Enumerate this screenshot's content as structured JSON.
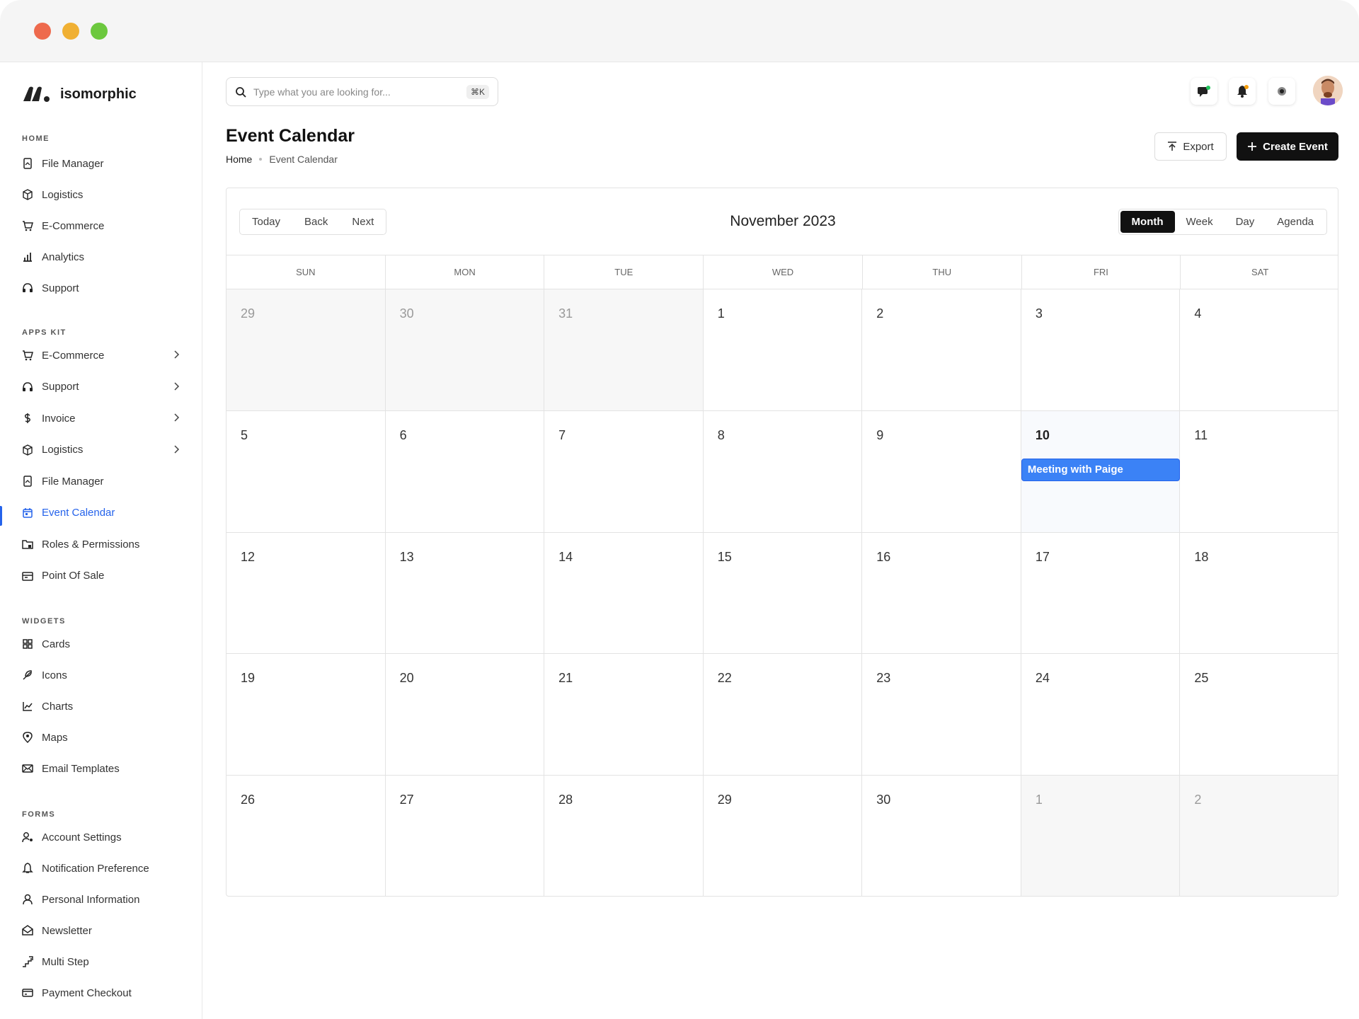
{
  "window": {
    "controls": [
      "close",
      "minimize",
      "maximize"
    ],
    "colors": {
      "close": "#ee6a4d",
      "minimize": "#f0b033",
      "maximize": "#6cc83e"
    }
  },
  "brand": {
    "name": "isomorphic"
  },
  "sidebar": {
    "sections": [
      {
        "label": "HOME",
        "items": [
          {
            "label": "File Manager",
            "icon": "file-icon"
          },
          {
            "label": "Logistics",
            "icon": "box-icon"
          },
          {
            "label": "E-Commerce",
            "icon": "cart-icon"
          },
          {
            "label": "Analytics",
            "icon": "chart-bar-icon"
          },
          {
            "label": "Support",
            "icon": "headset-icon"
          }
        ]
      },
      {
        "label": "APPS KIT",
        "items": [
          {
            "label": "E-Commerce",
            "icon": "cart-icon",
            "expandable": true
          },
          {
            "label": "Support",
            "icon": "headset-icon",
            "expandable": true
          },
          {
            "label": "Invoice",
            "icon": "dollar-icon",
            "expandable": true
          },
          {
            "label": "Logistics",
            "icon": "box-icon",
            "expandable": true
          },
          {
            "label": "File Manager",
            "icon": "file-icon"
          },
          {
            "label": "Event Calendar",
            "icon": "calendar-icon",
            "active": true
          },
          {
            "label": "Roles & Permissions",
            "icon": "folder-lock-icon"
          },
          {
            "label": "Point Of Sale",
            "icon": "register-icon"
          }
        ]
      },
      {
        "label": "WIDGETS",
        "items": [
          {
            "label": "Cards",
            "icon": "grid-icon"
          },
          {
            "label": "Icons",
            "icon": "feather-icon"
          },
          {
            "label": "Charts",
            "icon": "line-chart-icon"
          },
          {
            "label": "Maps",
            "icon": "map-pin-icon"
          },
          {
            "label": "Email Templates",
            "icon": "mail-icon"
          }
        ]
      },
      {
        "label": "FORMS",
        "items": [
          {
            "label": "Account Settings",
            "icon": "user-gear-icon"
          },
          {
            "label": "Notification Preference",
            "icon": "bell-icon"
          },
          {
            "label": "Personal Information",
            "icon": "user-icon"
          },
          {
            "label": "Newsletter",
            "icon": "envelope-open-icon"
          },
          {
            "label": "Multi Step",
            "icon": "steps-icon"
          },
          {
            "label": "Payment Checkout",
            "icon": "credit-card-icon"
          }
        ]
      }
    ]
  },
  "search": {
    "placeholder": "Type what you are looking for...",
    "shortcut": "⌘K"
  },
  "topbar_icons": [
    "messages-icon",
    "notification-bell-icon",
    "settings-gear-icon"
  ],
  "page": {
    "title": "Event Calendar",
    "breadcrumb": [
      "Home",
      "Event Calendar"
    ],
    "export_label": "Export",
    "create_label": "Create Event"
  },
  "calendar": {
    "nav": [
      "Today",
      "Back",
      "Next"
    ],
    "title": "November 2023",
    "views": [
      "Month",
      "Week",
      "Day",
      "Agenda"
    ],
    "active_view": "Month",
    "weekdays": [
      "SUN",
      "MON",
      "TUE",
      "WED",
      "THU",
      "FRI",
      "SAT"
    ],
    "days": [
      {
        "d": "29",
        "off": true
      },
      {
        "d": "30",
        "off": true
      },
      {
        "d": "31",
        "off": true
      },
      {
        "d": "1"
      },
      {
        "d": "2"
      },
      {
        "d": "3"
      },
      {
        "d": "4"
      },
      {
        "d": "5"
      },
      {
        "d": "6"
      },
      {
        "d": "7"
      },
      {
        "d": "8"
      },
      {
        "d": "9"
      },
      {
        "d": "10",
        "today": true,
        "event": "Meeting with Paige"
      },
      {
        "d": "11"
      },
      {
        "d": "12"
      },
      {
        "d": "13"
      },
      {
        "d": "14"
      },
      {
        "d": "15"
      },
      {
        "d": "16"
      },
      {
        "d": "17"
      },
      {
        "d": "18"
      },
      {
        "d": "19"
      },
      {
        "d": "20"
      },
      {
        "d": "21"
      },
      {
        "d": "22"
      },
      {
        "d": "23"
      },
      {
        "d": "24"
      },
      {
        "d": "25"
      },
      {
        "d": "26"
      },
      {
        "d": "27"
      },
      {
        "d": "28"
      },
      {
        "d": "29"
      },
      {
        "d": "30"
      },
      {
        "d": "1",
        "off": true
      },
      {
        "d": "2",
        "off": true
      }
    ],
    "event_color": "#3b82f6"
  }
}
